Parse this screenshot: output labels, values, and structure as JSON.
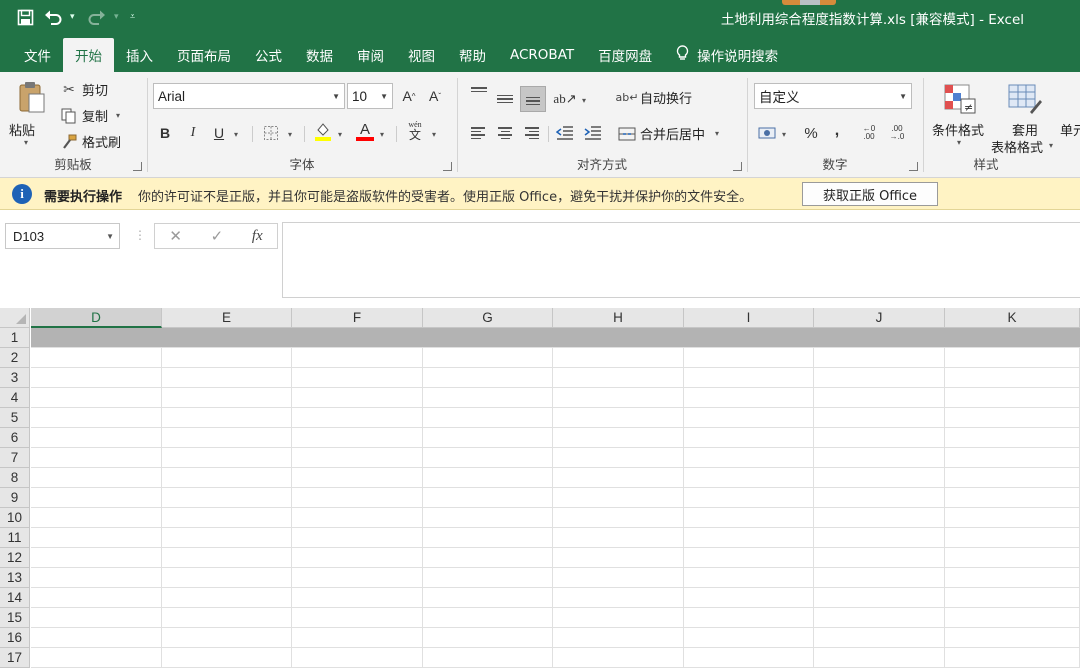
{
  "titlebar": {
    "document_title": "土地利用综合程度指数计算.xls  [兼容模式]  -  Excel",
    "qat": {
      "save_icon": "save-icon",
      "undo_icon": "undo-icon",
      "redo_icon": "redo-icon",
      "customize_icon": "customize-qat-icon"
    }
  },
  "tabs": [
    {
      "label": "文件"
    },
    {
      "label": "开始"
    },
    {
      "label": "插入"
    },
    {
      "label": "页面布局"
    },
    {
      "label": "公式"
    },
    {
      "label": "数据"
    },
    {
      "label": "审阅"
    },
    {
      "label": "视图"
    },
    {
      "label": "帮助"
    },
    {
      "label": "ACROBAT"
    },
    {
      "label": "百度网盘"
    },
    {
      "label": "操作说明搜索"
    }
  ],
  "ribbon": {
    "clipboard": {
      "paste_label": "粘贴",
      "cut_label": "剪切",
      "copy_label": "复制",
      "format_painter_label": "格式刷",
      "group_label": "剪贴板"
    },
    "font": {
      "font_name": "Arial",
      "font_size": "10",
      "bold": "B",
      "italic": "I",
      "underline": "U",
      "increase_font": "A",
      "decrease_font": "A",
      "font_color_letter": "A",
      "phonetic": "wén",
      "group_label": "字体",
      "highlight_color": "#ffff00",
      "font_color": "#ff0000"
    },
    "alignment": {
      "wrap_text_label": "自动换行",
      "merge_center_label": "合并后居中",
      "group_label": "对齐方式"
    },
    "number": {
      "format": "自定义",
      "percent": "%",
      "comma": ",",
      "group_label": "数字"
    },
    "styles": {
      "conditional_format_label": "条件格式",
      "table_format_label_1": "套用",
      "table_format_label_2": "表格格式",
      "cell_styles_label": "单元",
      "group_label": "样式"
    }
  },
  "infobar": {
    "title": "需要执行操作",
    "message": "你的许可证不是正版，并且你可能是盗版软件的受害者。使用正版 Office，避免干扰并保护你的文件安全。",
    "button_label": "获取正版 Office"
  },
  "formula_bar": {
    "name_box": "D103",
    "fx_label": "fx",
    "cancel_symbol": "✕",
    "enter_symbol": "✓",
    "formula": ""
  },
  "grid": {
    "selected_column": "D",
    "columns": [
      "D",
      "E",
      "F",
      "G",
      "H",
      "I",
      "J",
      "K"
    ],
    "rows": [
      "1",
      "2",
      "3",
      "4",
      "5",
      "6",
      "7",
      "8",
      "9",
      "10",
      "11",
      "12",
      "13",
      "14",
      "15",
      "16",
      "17"
    ]
  },
  "colors": {
    "excel_green": "#217346",
    "info_yellow": "#fff3c4",
    "info_blue": "#1e62b6"
  }
}
